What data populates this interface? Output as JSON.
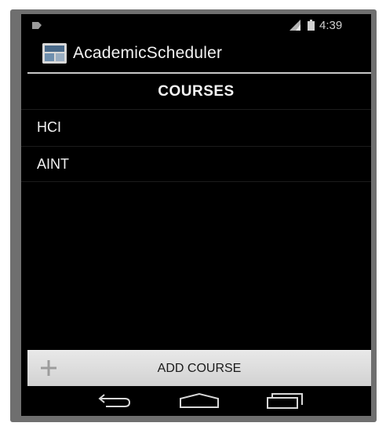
{
  "status_bar": {
    "time": "4:39"
  },
  "action_bar": {
    "title": "AcademicScheduler",
    "icon": "app-logo-icon"
  },
  "header": {
    "title": "COURSES"
  },
  "courses": [
    {
      "label": "HCI"
    },
    {
      "label": "AINT"
    }
  ],
  "add_button": {
    "label": "ADD COURSE",
    "icon": "plus-icon"
  },
  "nav_bar": {
    "icons": [
      "back-icon",
      "home-icon",
      "recents-icon"
    ]
  },
  "colors": {
    "background": "#000000",
    "button": "#dcdcdc",
    "frame": "#6f6f6f"
  }
}
